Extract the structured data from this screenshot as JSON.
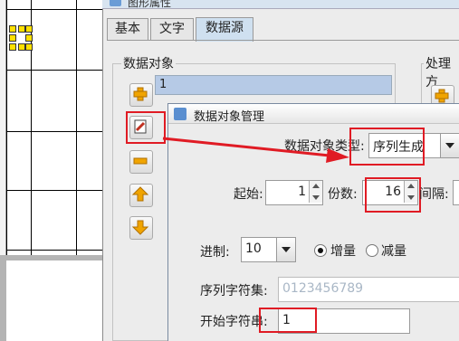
{
  "outer_dialog": {
    "title": "图形属性",
    "tabs": [
      "基本",
      "文字",
      "数据源"
    ],
    "active_tab": "数据源",
    "data_object_group": "数据对象",
    "processing_group": "处理方",
    "list_items": [
      "1"
    ],
    "side_buttons": [
      "add-icon",
      "edit-icon",
      "remove-icon",
      "move-up-icon",
      "move-down-icon"
    ]
  },
  "inner_dialog": {
    "title": "数据对象管理",
    "type_label": "数据对象类型:",
    "type_value": "序列生成",
    "start_label": "起始:",
    "start_value": "1",
    "copies_label": "份数:",
    "copies_value": "16",
    "interval_label": "间隔:",
    "base_label": "进制:",
    "base_value": "10",
    "increment_label": "增量",
    "decrement_label": "减量",
    "mode_selected": "增量",
    "charset_label": "序列字符集:",
    "charset_placeholder": "0123456789",
    "start_char_label": "开始字符串:",
    "start_char_value": "1"
  },
  "colors": {
    "highlight": "#e01b24",
    "accent": "#5b8fd0",
    "list_selected": "#b6cae6"
  }
}
